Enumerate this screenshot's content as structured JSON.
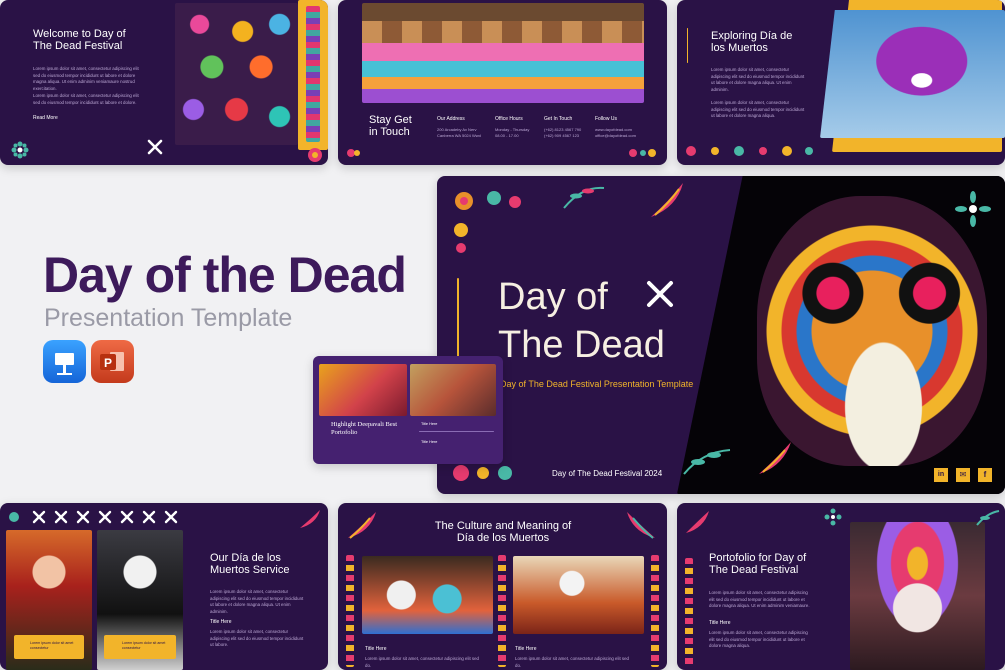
{
  "hero": {
    "title": "Day of the Dead",
    "subtitle": "Presentation Template"
  },
  "apps": [
    {
      "name": "keynote-icon",
      "color": "#1c7ff0"
    },
    {
      "name": "powerpoint-icon",
      "color": "#d24726"
    }
  ],
  "slide1": {
    "title": "Welcome to Day of The Dead Festival",
    "para1": "Lorem ipsum dolor sit amet, consectetur adipiscing elit sed do eiusmod tempor incididunt ut labore et dolore magna aliqua. Ut enim adminim veniamaure nostrud exercitation.",
    "para2": "Lorem ipsum dolor sit amet, consectetur adipiscing elit sed do eiusmod tempor incididunt ut labore et dolore.",
    "link": "Read More"
  },
  "slide2": {
    "title": "Stay Get in Touch",
    "cols": [
      {
        "label": "Our Address",
        "value": "200 Arcadeby Av Nerv Canberra WA 5024 Wwd"
      },
      {
        "label": "Office Hours",
        "value": "Monday - Thursday 08.00 - 17.00"
      },
      {
        "label": "Get In Touch",
        "value": "(+62) 8123 4567 790 (+62) 909 4567 123"
      },
      {
        "label": "Follow Us",
        "value": "www.dayofdead.com office@dayofdead.com"
      }
    ]
  },
  "slide3": {
    "title": "Exploring Día de los Muertos",
    "para1": "Lorem ipsum dolor sit amet, consectetur adipiscing elit sed do eiusmod tempor incididunt ut labore et dolore magna aliqua. Ut enim adminim.",
    "para2": "Lorem ipsum dolor sit amet, consectetur adipiscing elit sed do eiusmod tempor incididunt ut labore et dolore magna aliqua."
  },
  "main": {
    "title_line1": "Day of",
    "title_line2": "The Dead",
    "tagline": "Day of The Dead Festival Presentation Template",
    "footer": "Day of The Dead Festival 2024",
    "socials": [
      "in",
      "✉",
      "f"
    ]
  },
  "small": {
    "title": "Highlight Deepavali Best Portofolio",
    "item1": "Title Here",
    "item2": "Title Here"
  },
  "slide4": {
    "title": "Our Día de los Muertos Service",
    "para": "Lorem ipsum dolor sit amet, consectetur adipiscing elit sed do eiusmod tempor incididunt ut labore et dolore magna aliqua. Ut enim adminim.",
    "sub": "Title Here",
    "sub_para": "Lorem ipsum dolor sit amet, consectetur adipiscing elit sed do eiusmod tempor incididunt ut labore.",
    "cap1": "Lorem ipsum dolor sit amet consectetur",
    "cap2": "Lorem ipsum dolor sit amet consectetur"
  },
  "slide5": {
    "title": "The Culture and Meaning of Día de los Muertos",
    "cap1": "Title Here",
    "cap2": "Title Here",
    "para": "Lorem ipsum dolor sit amet, consectetur adipiscing elit sed do."
  },
  "slide6": {
    "title": "Portofolio for Day of The Dead Festival",
    "para": "Lorem ipsum dolor sit amet, consectetur adipiscing elit sed do eiusmod tempor incididunt ut labore et dolore magna aliqua. Ut enim adminim veniamaure.",
    "sub": "Title Here",
    "sub_para": "Lorem ipsum dolor sit amet, consectetur adipiscing elit sed do eiusmod tempor incididunt ut labore et dolore magna aliqua."
  }
}
